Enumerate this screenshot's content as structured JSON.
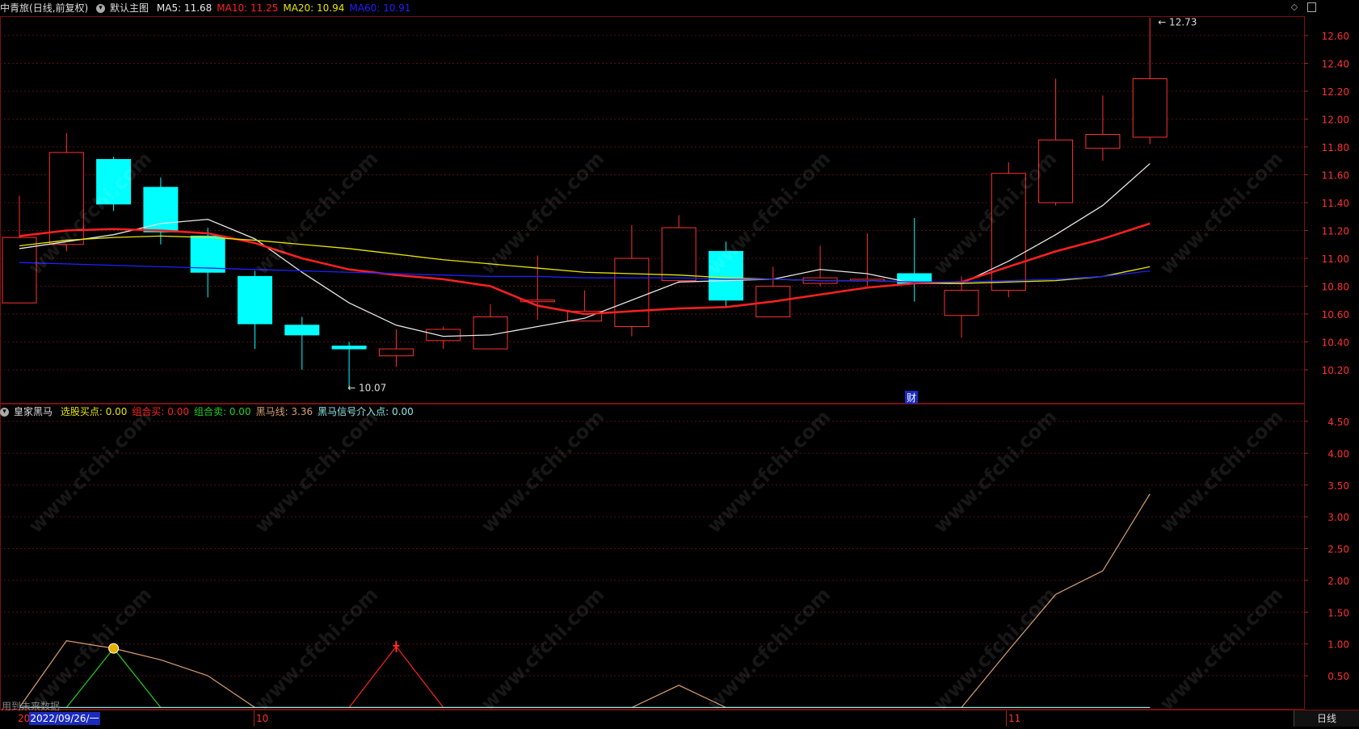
{
  "header": {
    "stock_name": "中青旅",
    "mode": "(日线,前复权)",
    "template": "默认主图",
    "ma": [
      {
        "label": "MA5:",
        "value": "11.68",
        "color": "#e6e6e6"
      },
      {
        "label": "MA10:",
        "value": "11.25",
        "color": "#ff2020"
      },
      {
        "label": "MA20:",
        "value": "10.94",
        "color": "#e6e600"
      },
      {
        "label": "MA60:",
        "value": "10.91",
        "color": "#2020ff"
      }
    ]
  },
  "indicator": {
    "name": "皇家黑马",
    "fields": [
      {
        "label": "选股买点:",
        "value": "0.00",
        "color": "#e6e600"
      },
      {
        "label": "组合买:",
        "value": "0.00",
        "color": "#ff2020"
      },
      {
        "label": "组合卖:",
        "value": "0.00",
        "color": "#20d020"
      },
      {
        "label": "黑马线:",
        "value": "3.36",
        "color": "#d9a070"
      },
      {
        "label": "黑马信号介入点:",
        "value": "0.00",
        "color": "#8fe6e6"
      }
    ]
  },
  "footer": {
    "hint": "用到未来数据",
    "date_cursor": "2022/09/26/一",
    "month_labels": [
      "20",
      "10",
      "11"
    ],
    "period": "日线"
  },
  "annotations": {
    "high_label": "12.73",
    "low_label": "10.07",
    "finance_marker": "财"
  },
  "watermark_text": "www.cfchi.com",
  "chart_data": [
    {
      "type": "candlestick",
      "title": "中青旅 (日线,前复权)",
      "ylim": [
        10.07,
        12.73
      ],
      "yticks": [
        "12.60",
        "12.40",
        "12.20",
        "12.00",
        "11.80",
        "11.60",
        "11.40",
        "11.20",
        "11.00",
        "10.80",
        "10.60",
        "10.40",
        "10.20"
      ],
      "candles": [
        {
          "o": 10.68,
          "h": 11.45,
          "l": 10.68,
          "c": 11.15
        },
        {
          "o": 11.1,
          "h": 11.9,
          "l": 11.05,
          "c": 11.76
        },
        {
          "o": 11.71,
          "h": 11.73,
          "l": 11.34,
          "c": 11.39
        },
        {
          "o": 11.51,
          "h": 11.58,
          "l": 11.1,
          "c": 11.19
        },
        {
          "o": 11.16,
          "h": 11.22,
          "l": 10.72,
          "c": 10.9
        },
        {
          "o": 10.87,
          "h": 10.91,
          "l": 10.35,
          "c": 10.53
        },
        {
          "o": 10.52,
          "h": 10.58,
          "l": 10.2,
          "c": 10.45
        },
        {
          "o": 10.37,
          "h": 10.4,
          "l": 10.07,
          "c": 10.35
        },
        {
          "o": 10.3,
          "h": 10.49,
          "l": 10.22,
          "c": 10.35
        },
        {
          "o": 10.41,
          "h": 10.51,
          "l": 10.35,
          "c": 10.49
        },
        {
          "o": 10.35,
          "h": 10.67,
          "l": 10.35,
          "c": 10.58
        },
        {
          "o": 10.7,
          "h": 11.02,
          "l": 10.56,
          "c": 10.7
        },
        {
          "o": 10.55,
          "h": 10.77,
          "l": 10.55,
          "c": 10.62
        },
        {
          "o": 10.51,
          "h": 11.24,
          "l": 10.44,
          "c": 11.0
        },
        {
          "o": 10.84,
          "h": 11.31,
          "l": 10.82,
          "c": 11.22
        },
        {
          "o": 11.05,
          "h": 11.12,
          "l": 10.65,
          "c": 10.7
        },
        {
          "o": 10.58,
          "h": 10.94,
          "l": 10.58,
          "c": 10.8
        },
        {
          "o": 10.82,
          "h": 11.09,
          "l": 10.8,
          "c": 10.86
        },
        {
          "o": 10.84,
          "h": 11.18,
          "l": 10.8,
          "c": 10.85
        },
        {
          "o": 10.89,
          "h": 11.29,
          "l": 10.69,
          "c": 10.82
        },
        {
          "o": 10.59,
          "h": 10.87,
          "l": 10.43,
          "c": 10.77
        },
        {
          "o": 10.77,
          "h": 11.69,
          "l": 10.72,
          "c": 11.61
        },
        {
          "o": 11.4,
          "h": 12.29,
          "l": 11.38,
          "c": 11.85
        },
        {
          "o": 11.79,
          "h": 12.17,
          "l": 11.7,
          "c": 11.89
        },
        {
          "o": 11.87,
          "h": 12.73,
          "l": 11.82,
          "c": 12.29
        }
      ],
      "series": [
        {
          "name": "MA5",
          "color": "#e6e6e6",
          "values": [
            11.07,
            11.12,
            11.17,
            11.25,
            11.28,
            11.14,
            10.9,
            10.68,
            10.52,
            10.44,
            10.45,
            10.51,
            10.57,
            10.7,
            10.83,
            10.84,
            10.85,
            10.92,
            10.89,
            10.82,
            10.82,
            10.98,
            11.17,
            11.38,
            11.68
          ]
        },
        {
          "name": "MA10",
          "color": "#ff2020",
          "values": [
            11.16,
            11.2,
            11.21,
            11.2,
            11.18,
            11.11,
            11.0,
            10.92,
            10.88,
            10.85,
            10.8,
            10.66,
            10.6,
            10.62,
            10.64,
            10.65,
            10.69,
            10.74,
            10.79,
            10.82,
            10.83,
            10.94,
            11.05,
            11.14,
            11.25
          ]
        },
        {
          "name": "MA20",
          "color": "#e6e600",
          "values": [
            11.09,
            11.13,
            11.15,
            11.16,
            11.15,
            11.13,
            11.1,
            11.07,
            11.03,
            10.99,
            10.96,
            10.93,
            10.9,
            10.89,
            10.88,
            10.86,
            10.85,
            10.84,
            10.84,
            10.83,
            10.82,
            10.83,
            10.84,
            10.87,
            10.94
          ]
        },
        {
          "name": "MA60",
          "color": "#2020ff",
          "values": [
            10.97,
            10.96,
            10.95,
            10.94,
            10.93,
            10.92,
            10.91,
            10.9,
            10.89,
            10.88,
            10.87,
            10.87,
            10.86,
            10.86,
            10.86,
            10.85,
            10.85,
            10.84,
            10.84,
            10.83,
            10.83,
            10.84,
            10.85,
            10.87,
            10.91
          ]
        }
      ]
    },
    {
      "type": "line",
      "title": "皇家黑马",
      "ylim": [
        0,
        4.7
      ],
      "yticks": [
        "4.50",
        "4.00",
        "3.50",
        "3.00",
        "2.50",
        "2.00",
        "1.50",
        "1.00",
        "0.50"
      ],
      "series": [
        {
          "name": "黑马线",
          "color": "#d9a070",
          "values": [
            0,
            1.05,
            0.93,
            0.75,
            0.5,
            0,
            0,
            0,
            0,
            0,
            0,
            0,
            0,
            0,
            0.35,
            0,
            0,
            0,
            0,
            0,
            0,
            0.9,
            1.78,
            2.15,
            3.36
          ]
        },
        {
          "name": "选股买点",
          "color": "#20d020",
          "values": [
            null,
            0,
            0.93,
            0,
            null,
            null,
            null,
            null,
            null,
            null,
            null,
            null,
            null,
            null,
            null,
            null,
            null,
            null,
            null,
            null,
            null,
            null,
            null,
            null,
            null
          ]
        },
        {
          "name": "组合买",
          "color": "#ff2020",
          "values": [
            null,
            null,
            null,
            null,
            null,
            null,
            null,
            0,
            0.96,
            0,
            null,
            null,
            null,
            null,
            null,
            null,
            null,
            null,
            null,
            null,
            null,
            null,
            null,
            null,
            null
          ]
        },
        {
          "name": "黑马信号介入点",
          "color": "#8fe6e6",
          "values": [
            0,
            0,
            0,
            0,
            0,
            0,
            0,
            0,
            0,
            0,
            0,
            0,
            0,
            0,
            0,
            0,
            0,
            0,
            0,
            0,
            0,
            0,
            0,
            0,
            0
          ]
        }
      ]
    }
  ]
}
